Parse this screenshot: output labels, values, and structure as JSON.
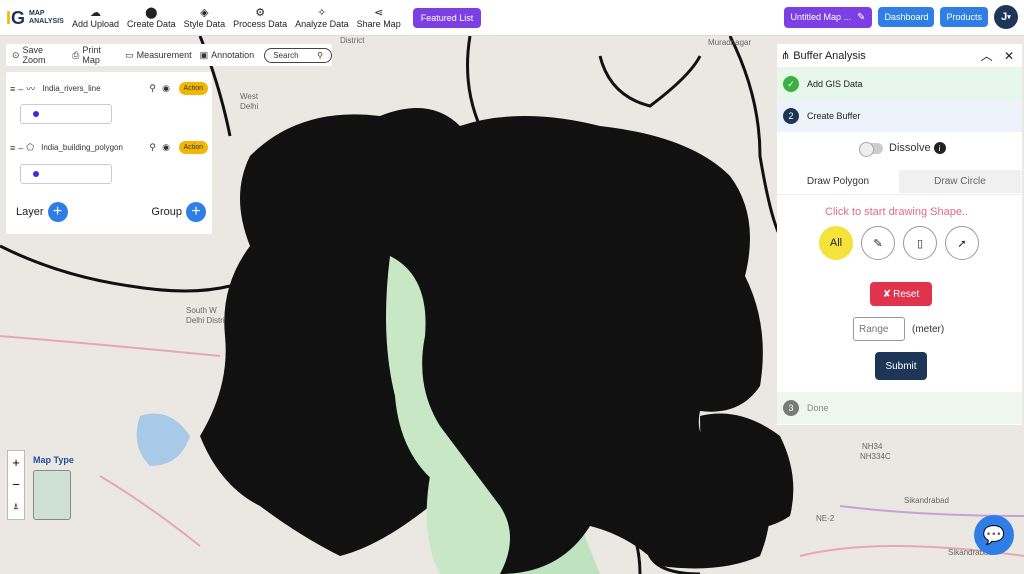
{
  "app": {
    "logo_mark": "G",
    "logo_line1": "MAP",
    "logo_line2": "ANALYSIS"
  },
  "nav": [
    {
      "label": "Add Upload",
      "icon": "cloud-upload-icon",
      "glyph": "☁"
    },
    {
      "label": "Create Data",
      "icon": "pin-icon",
      "glyph": "⬤"
    },
    {
      "label": "Style Data",
      "icon": "paint-bucket-icon",
      "glyph": "◈"
    },
    {
      "label": "Process Data",
      "icon": "process-icon",
      "glyph": "⚙"
    },
    {
      "label": "Analyze Data",
      "icon": "analyze-icon",
      "glyph": "✧"
    },
    {
      "label": "Share Map",
      "icon": "share-icon",
      "glyph": "⋖"
    }
  ],
  "featured": "Featured List",
  "header_right": {
    "map_title": "Untitled Map ...",
    "dashboard": "Dashboard",
    "products": "Products",
    "avatar": "J"
  },
  "maptools": {
    "save_zoom": "Save Zoom",
    "print_map": "Print Map",
    "measurement": "Measurement",
    "annotation": "Annotation",
    "search_placeholder": "Search"
  },
  "layers": [
    {
      "name": "India_rivers_line",
      "action": "Action"
    },
    {
      "name": "India_building_polygon",
      "action": "Action"
    }
  ],
  "layer_group": {
    "layer": "Layer",
    "group": "Group"
  },
  "map_type": "Map Type",
  "map_labels": [
    "West",
    "Delhi",
    "South W",
    "Delhi Distri",
    "District",
    "Muradnagar",
    "NH34",
    "NH334C",
    "Sikandrabad",
    "NE-2",
    "Sikandrabad"
  ],
  "buffer": {
    "title": "Buffer Analysis",
    "step1": {
      "num": "✓",
      "label": "Add GIS Data"
    },
    "step2": {
      "num": "2",
      "label": "Create Buffer"
    },
    "step3": {
      "num": "3",
      "label": "Done"
    },
    "dissolve": "Dissolve",
    "tab_polygon": "Draw Polygon",
    "tab_circle": "Draw Circle",
    "click_text": "Click to start drawing Shape..",
    "shape_all": "All",
    "reset": "Reset",
    "range_placeholder": "Range",
    "unit": "(meter)",
    "submit": "Submit"
  },
  "colors": {
    "accent_purple": "#7b3fe4",
    "accent_blue": "#2f7ee6",
    "reset_red": "#e0344e",
    "submit_navy": "#1d3557",
    "action_yellow": "#f2b705"
  }
}
